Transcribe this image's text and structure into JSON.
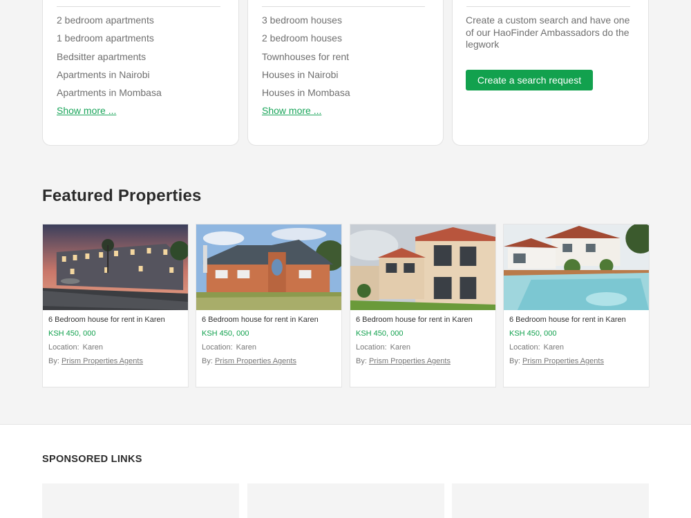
{
  "apartments_card": {
    "links": [
      "2 bedroom apartments",
      "1 bedroom apartments",
      "Bedsitter apartments",
      "Apartments in Nairobi",
      "Apartments in Mombasa"
    ],
    "show_more": "Show more ..."
  },
  "houses_card": {
    "links": [
      "3 bedroom houses",
      "2 bedroom houses",
      "Townhouses for rent",
      "Houses in Nairobi",
      "Houses in Mombasa"
    ],
    "show_more": "Show more ..."
  },
  "request_card": {
    "description": "Create a custom search and have one of our HaoFinder Ambassadors do the legwork",
    "button": "Create a search request"
  },
  "featured": {
    "title": "Featured Properties",
    "location_label": "Location:",
    "by_label": "By:",
    "properties": [
      {
        "title": "6 Bedroom house for rent in Karen",
        "price": "KSH 450, 000",
        "location": "Karen",
        "agent": "Prism Properties Agents"
      },
      {
        "title": "6 Bedroom house for rent in Karen",
        "price": "KSH 450, 000",
        "location": "Karen",
        "agent": "Prism Properties Agents"
      },
      {
        "title": "6 Bedroom house for rent in Karen",
        "price": "KSH 450, 000",
        "location": "Karen",
        "agent": "Prism Properties Agents"
      },
      {
        "title": "6 Bedroom house for rent in Karen",
        "price": "KSH 450, 000",
        "location": "Karen",
        "agent": "Prism Properties Agents"
      }
    ]
  },
  "sponsored": {
    "title": "SPONSORED LINKS"
  },
  "colors": {
    "accent_green": "#12a14e",
    "link_green": "#1aa55a",
    "background": "#f4f4f4"
  }
}
